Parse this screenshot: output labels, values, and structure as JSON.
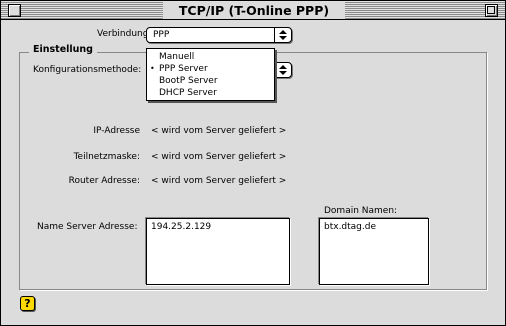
{
  "window": {
    "title": "TCP/IP (T-Online PPP)"
  },
  "verbindung": {
    "label": "Verbindung:",
    "value": "PPP"
  },
  "einstellung": {
    "group_title": "Einstellung",
    "konfig_label": "Konfigurationsmethode:",
    "menu_items": [
      {
        "label": "Manuell",
        "checked": false
      },
      {
        "label": "PPP Server",
        "checked": true
      },
      {
        "label": "BootP Server",
        "checked": false
      },
      {
        "label": "DHCP Server",
        "checked": false
      }
    ],
    "check_mark": "•",
    "ip_label": "IP-Adresse",
    "ip_value": "< wird vom Server geliefert >",
    "mask_label": "Teilnetzmaske:",
    "mask_value": "< wird vom Server geliefert >",
    "router_label": "Router Adresse:",
    "router_value": "< wird vom Server geliefert >",
    "dns_label": "Name Server Adresse:",
    "dns_value": "194.25.2.129",
    "domain_label": "Domain Namen:",
    "domain_value": "btx.dtag.de"
  },
  "help": {
    "icon": "help-icon",
    "glyph": "?"
  },
  "colors": {
    "window_bg": "#dcdcdc",
    "help_icon": "#ffd800"
  }
}
